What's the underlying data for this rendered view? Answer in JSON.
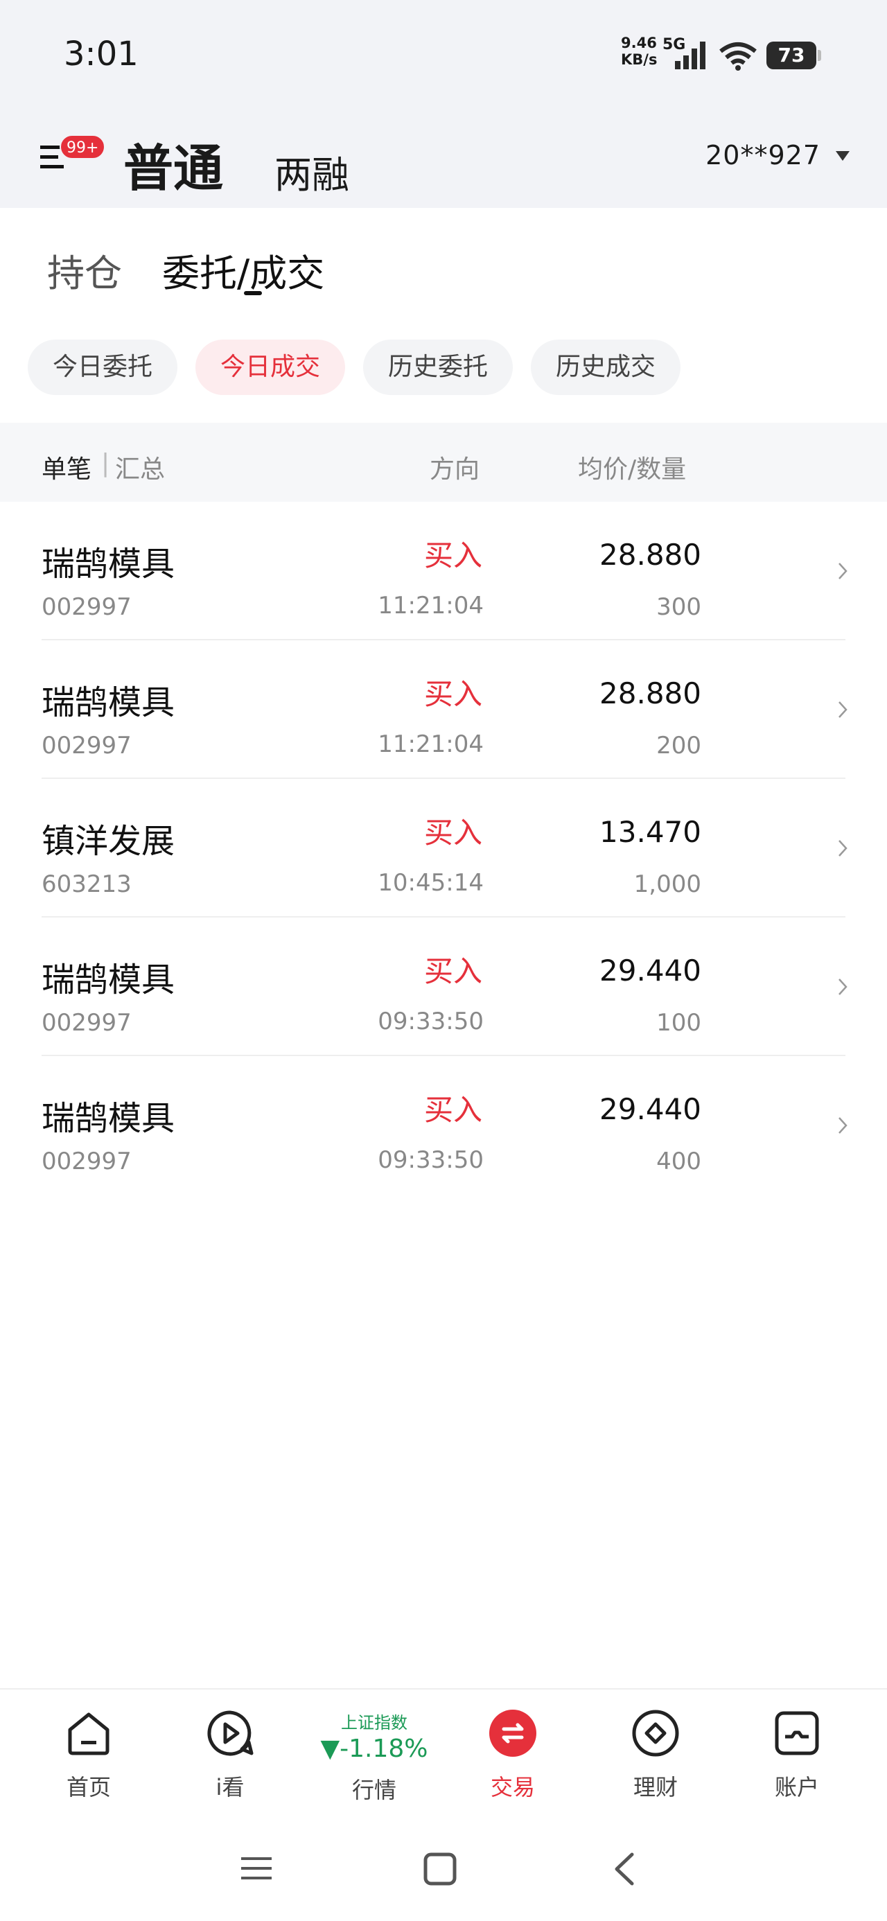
{
  "status_bar": {
    "time": "3:01",
    "net_speed_value": "9.46",
    "net_speed_unit": "KB/s",
    "network": "5G",
    "battery": "73"
  },
  "header": {
    "menu_badge": "99+",
    "account_type_active": "普通",
    "account_type_other": "两融",
    "account_id": "20**927"
  },
  "main_tabs": {
    "holdings": "持仓",
    "orders": "委托/成交"
  },
  "sub_tabs": [
    "今日委托",
    "今日成交",
    "历史委托",
    "历史成交"
  ],
  "active_sub_tab": 1,
  "table_header": {
    "single": "单笔",
    "separator": "|",
    "summary": "汇总",
    "direction": "方向",
    "avg_qty": "均价/数量"
  },
  "trades": [
    {
      "name": "瑞鹄模具",
      "code": "002997",
      "side": "买入",
      "time": "11:21:04",
      "price": "28.880",
      "qty": "300"
    },
    {
      "name": "瑞鹄模具",
      "code": "002997",
      "side": "买入",
      "time": "11:21:04",
      "price": "28.880",
      "qty": "200"
    },
    {
      "name": "镇洋发展",
      "code": "603213",
      "side": "买入",
      "time": "10:45:14",
      "price": "13.470",
      "qty": "1,000"
    },
    {
      "name": "瑞鹄模具",
      "code": "002997",
      "side": "买入",
      "time": "09:33:50",
      "price": "29.440",
      "qty": "100"
    },
    {
      "name": "瑞鹄模具",
      "code": "002997",
      "side": "买入",
      "time": "09:33:50",
      "price": "29.440",
      "qty": "400"
    }
  ],
  "bottom_nav": {
    "home": "首页",
    "watch": "i看",
    "market_index_name": "上证指数",
    "market_index_change": "▼-1.18%",
    "market": "行情",
    "trade": "交易",
    "wealth": "理财",
    "account": "账户"
  },
  "colors": {
    "accent": "#e5303b",
    "down": "#1b9a56"
  }
}
